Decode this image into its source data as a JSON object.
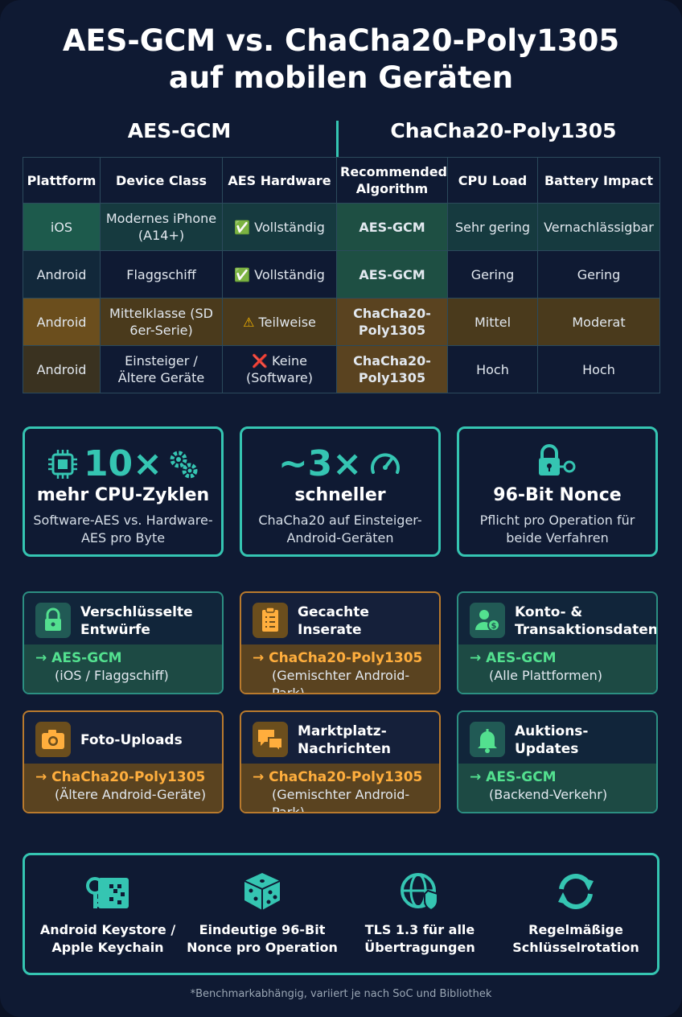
{
  "title": {
    "line1": "AES-GCM vs. ChaCha20-Poly1305",
    "line2": "auf mobilen Geräten"
  },
  "columns": {
    "left": "AES-GCM",
    "right": "ChaCha20-Poly1305"
  },
  "table": {
    "headers": [
      "Plattform",
      "Device Class",
      "AES Hardware",
      "Recommended Algorithm",
      "CPU Load",
      "Battery Impact"
    ],
    "rows": [
      {
        "platform": "iOS",
        "device": "Modernes iPhone (A14+)",
        "hw_icon": "✅",
        "hw": "Vollständig",
        "algo": "AES-GCM",
        "cpu": "Sehr gering",
        "battery": "Vernachlässigbar"
      },
      {
        "platform": "Android",
        "device": "Flaggschiff",
        "hw_icon": "✅",
        "hw": "Vollständig",
        "algo": "AES-GCM",
        "cpu": "Gering",
        "battery": "Gering"
      },
      {
        "platform": "Android",
        "device": "Mittelklasse (SD 6er-Serie)",
        "hw_icon": "⚠",
        "hw": "Teilweise",
        "algo": "ChaCha20-Poly1305",
        "cpu": "Mittel",
        "battery": "Moderat"
      },
      {
        "platform": "Android",
        "device": "Einsteiger / Ältere Geräte",
        "hw_icon": "❌",
        "hw": "Keine (Software)",
        "algo": "ChaCha20-Poly1305",
        "cpu": "Hoch",
        "battery": "Hoch"
      }
    ]
  },
  "stats": [
    {
      "value": "10×",
      "label": "mehr CPU-Zyklen",
      "desc": "Software-AES vs. Hardware-AES pro Byte",
      "icons": [
        "chip-icon",
        "gears-icon"
      ]
    },
    {
      "value": "~3×",
      "label": "schneller",
      "desc": "ChaCha20 auf Einsteiger-Android-Geräten",
      "icons": [
        "speedometer-icon"
      ]
    },
    {
      "value": "",
      "label": "96-Bit Nonce",
      "desc": "Pflicht pro Operation für beide Verfahren",
      "icons": [
        "lock-key-icon"
      ]
    }
  ],
  "use_cases": [
    {
      "title": "Verschlüsselte Entwürfe",
      "algo": "AES-GCM",
      "sub": "(iOS / Flaggschiff)",
      "theme": "teal",
      "icon": "lock-icon"
    },
    {
      "title": "Gecachte Inserate",
      "algo": "ChaCha20-Poly1305",
      "sub": "(Gemischter Android-Park)",
      "theme": "orange",
      "icon": "clipboard-icon"
    },
    {
      "title": "Konto- & Transaktionsdaten",
      "algo": "AES-GCM",
      "sub": "(Alle Plattformen)",
      "theme": "teal",
      "icon": "user-money-icon"
    },
    {
      "title": "Foto-Uploads",
      "algo": "ChaCha20-Poly1305",
      "sub": "(Ältere Android-Geräte)",
      "theme": "orange",
      "icon": "camera-icon"
    },
    {
      "title": "Marktplatz-Nachrichten",
      "algo": "ChaCha20-Poly1305",
      "sub": "(Gemischter Android-Park)",
      "theme": "orange",
      "icon": "chat-icon"
    },
    {
      "title": "Auktions-Updates",
      "algo": "AES-GCM",
      "sub": "(Backend-Verkehr)",
      "theme": "teal",
      "icon": "bell-icon"
    }
  ],
  "arrow": "→",
  "best_practices": [
    {
      "text": "Android Keystore / Apple Keychain",
      "icon": "keystore-icon"
    },
    {
      "text": "Eindeutige 96-Bit Nonce pro Operation",
      "icon": "dice-icon"
    },
    {
      "text": "TLS 1.3 für alle Übertragungen",
      "icon": "globe-shield-icon"
    },
    {
      "text": "Regelmäßige Schlüsselrotation",
      "icon": "rotate-icon"
    }
  ],
  "footnote": "*Benchmarkabhängig, variiert je nach SoC und Bibliothek",
  "colors": {
    "teal": "#35c5b2",
    "green": "#53e08f",
    "orange": "#ffae3d",
    "background": "#0f1a33"
  }
}
